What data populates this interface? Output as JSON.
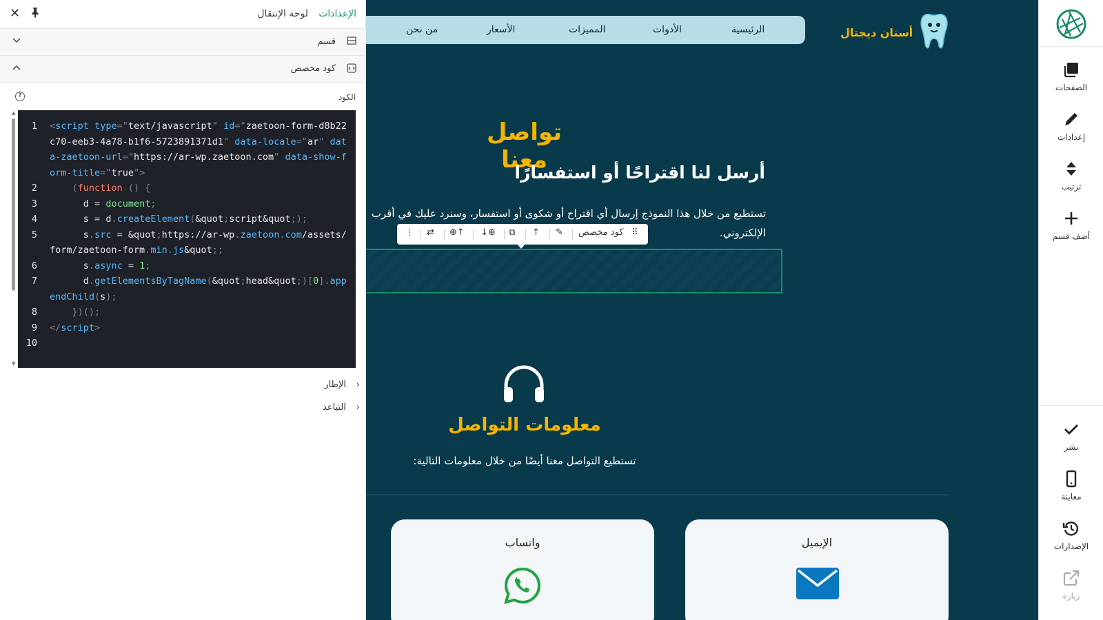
{
  "panel": {
    "tab_settings": "الإعدادات",
    "tab_nav": "لوحة الإنتقال",
    "section_label": "قسم",
    "custom_code_label": "كود مخصص",
    "code_label": "الكود",
    "frame_label": "الإطار",
    "spacing_label": "التباعد",
    "code_lines": [
      "1",
      "2",
      "3",
      "4",
      "5",
      "6",
      "7",
      "8",
      "9",
      "10"
    ]
  },
  "site": {
    "brand": "أسنان ديجتال",
    "nav": [
      "الرئيسية",
      "الأدوات",
      "المميزات",
      "الأسعار",
      "من نحن"
    ],
    "heading_contact": "تواصل معنا",
    "heading_send": "أرسل لنا اقتراحًا أو استفسارًا",
    "desc_line1": "تستطيع من خلال هذا النموذج إرسال أي اقتراح أو شكوى أو استفسار، وسنرد عليك في أقرب",
    "desc_line2": "الإلكتروني.",
    "toolbar_label": "كود مخصص",
    "heading_info": "معلومات التواصل",
    "info_desc": "تستطيع التواصل معنا أيضًا من خلال معلومات التالية:",
    "card_email": "الإيميل",
    "card_whatsapp": "واتساب"
  },
  "sidebar": {
    "pages": "الصفحات",
    "settings": "إعدادات",
    "order": "ترتيب",
    "add_section": "أضف قسم",
    "publish": "نشر",
    "preview": "معاينة",
    "versions": "الإصدارات",
    "visit": "زيارة"
  },
  "colors": {
    "canvas_bg": "#093a4c",
    "accent": "#f4b400",
    "nav_bg": "#b9dde6",
    "tab_active": "#1f9a7c",
    "editor_bg": "#1e2128"
  }
}
